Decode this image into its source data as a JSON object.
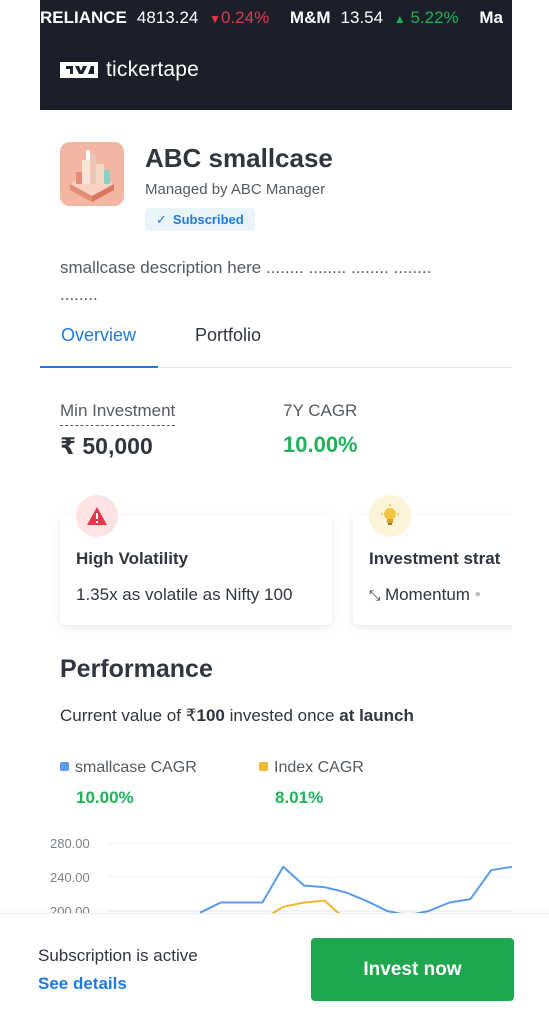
{
  "ticker": [
    {
      "symbol": "RELIANCE",
      "price": "4813.24",
      "arrow": "▼",
      "change": "0.24%",
      "direction": "down"
    },
    {
      "symbol": "M&M",
      "price": "13.54",
      "arrow": "▲",
      "change": "5.22%",
      "direction": "up"
    },
    {
      "symbol": "Ma",
      "price": "",
      "arrow": "",
      "change": "",
      "direction": ""
    }
  ],
  "brand": {
    "name": "tickertape"
  },
  "smallcase": {
    "title": "ABC smallcase",
    "manager": "Managed by ABC Manager",
    "badge": "Subscribed",
    "description": "smallcase description here ........ ........ ........ ........ ........"
  },
  "tabs": [
    {
      "label": "Overview",
      "active": true
    },
    {
      "label": "Portfolio",
      "active": false
    }
  ],
  "stats": {
    "min_investment_label": "Min Investment",
    "min_investment_value": "₹ 50,000",
    "cagr_label": "7Y CAGR",
    "cagr_value": "10.00%"
  },
  "cards": [
    {
      "icon": "warning-icon",
      "title": "High Volatility",
      "text": "1.35x as volatile as Nifty 100"
    },
    {
      "icon": "lightbulb-icon",
      "title": "Investment strat",
      "text": "Momentum"
    }
  ],
  "performance": {
    "title": "Performance",
    "subtitle_pre": "Current value of ₹",
    "subtitle_amount": "100",
    "subtitle_mid": " invested once ",
    "subtitle_post": "at launch",
    "legend": [
      {
        "name": "smallcase CAGR",
        "value": "10.00%",
        "color": "#5b9bea"
      },
      {
        "name": "Index CAGR",
        "value": "8.01%",
        "color": "#f2b632"
      }
    ]
  },
  "chart_data": {
    "type": "line",
    "y_ticks": [
      "280.00",
      "240.00",
      "200.00"
    ],
    "ylim": [
      200,
      280
    ],
    "series": [
      {
        "name": "smallcase CAGR",
        "color": "#5b9bea",
        "values": [
          198,
          210,
          210,
          210,
          252,
          230,
          228,
          222,
          212,
          200,
          195,
          200,
          210,
          214,
          248,
          252
        ]
      },
      {
        "name": "Index CAGR",
        "color": "#f2b632",
        "values": [
          190,
          190,
          190,
          190,
          205,
          210,
          212,
          190,
          190,
          190,
          190,
          190,
          190,
          190,
          190,
          190
        ]
      }
    ]
  },
  "footer": {
    "status": "Subscription is active",
    "link": "See details",
    "cta": "Invest now"
  },
  "colors": {
    "accent": "#1f7ae0",
    "positive": "#20b15a",
    "negative": "#e5394b",
    "cta": "#1fa74f",
    "header_bg": "#1b1f2a"
  }
}
